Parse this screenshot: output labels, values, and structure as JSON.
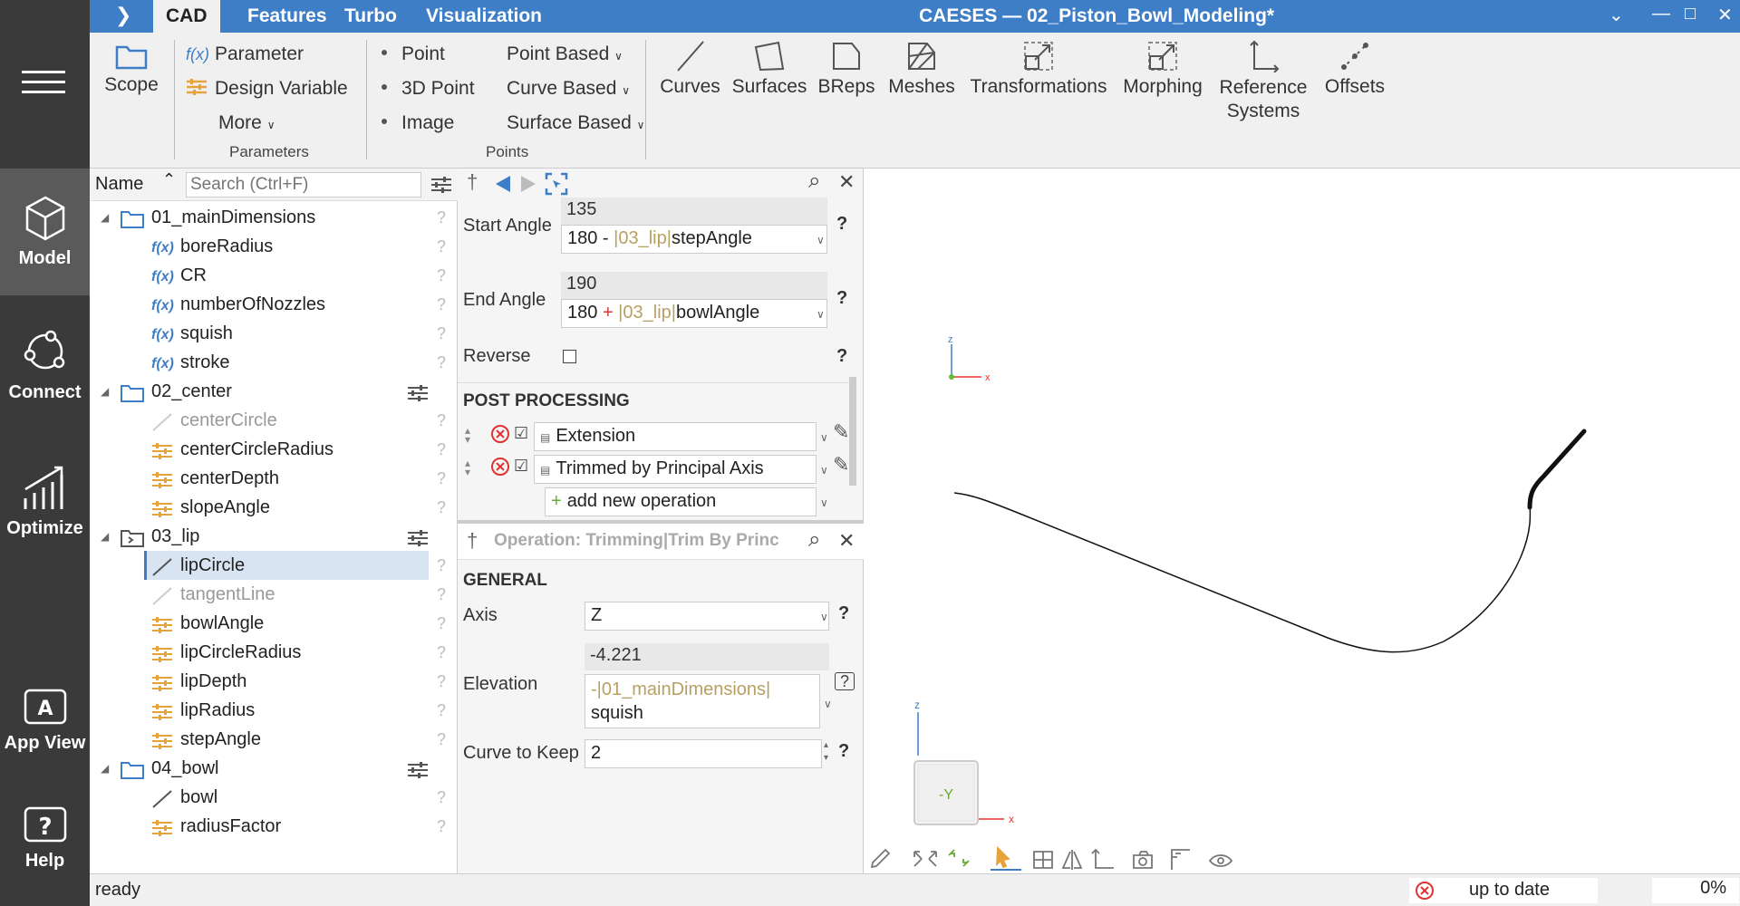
{
  "nav": {
    "model": "Model",
    "connect": "Connect",
    "optimize": "Optimize",
    "app_view": "App View",
    "help": "Help"
  },
  "titlebar": {
    "tabs": [
      "CAD",
      "Features",
      "Turbo",
      "Visualization"
    ],
    "window_title": "CAESES — 02_Piston_Bowl_Modeling*"
  },
  "ribbon": {
    "scope": "Scope",
    "parameter": "Parameter",
    "design_variable": "Design Variable",
    "more": "More",
    "parameters_group": "Parameters",
    "point": "Point",
    "point3d": "3D Point",
    "image": "Image",
    "point_based": "Point Based",
    "curve_based": "Curve Based",
    "surface_based": "Surface Based",
    "points_group": "Points",
    "curves": "Curves",
    "surfaces": "Surfaces",
    "breps": "BReps",
    "meshes": "Meshes",
    "transformations": "Transformations",
    "morphing": "Morphing",
    "reference_systems_1": "Reference",
    "reference_systems_2": "Systems",
    "offsets": "Offsets",
    "fx": "f(x)"
  },
  "tree": {
    "name_header": "Name",
    "search_placeholder": "Search (Ctrl+F)",
    "fx": "f(x)",
    "q": "?",
    "items": [
      {
        "label": "01_mainDimensions"
      },
      {
        "label": "boreRadius"
      },
      {
        "label": "CR"
      },
      {
        "label": "numberOfNozzles"
      },
      {
        "label": "squish"
      },
      {
        "label": "stroke"
      },
      {
        "label": "02_center"
      },
      {
        "label": "centerCircle"
      },
      {
        "label": "centerCircleRadius"
      },
      {
        "label": "centerDepth"
      },
      {
        "label": "slopeAngle"
      },
      {
        "label": "03_lip"
      },
      {
        "label": "lipCircle"
      },
      {
        "label": "tangentLine"
      },
      {
        "label": "bowlAngle"
      },
      {
        "label": "lipCircleRadius"
      },
      {
        "label": "lipDepth"
      },
      {
        "label": "lipRadius"
      },
      {
        "label": "stepAngle"
      },
      {
        "label": "04_bowl"
      },
      {
        "label": "bowl"
      },
      {
        "label": "radiusFactor"
      }
    ]
  },
  "editor": {
    "start_angle_label": "Start Angle",
    "start_angle_value": "135",
    "start_angle_expr_pre": "180 - ",
    "start_angle_expr_ref": "|03_lip|",
    "start_angle_expr_post": "stepAngle",
    "end_angle_label": "End Angle",
    "end_angle_value": "190",
    "end_angle_expr_pre": "180 ",
    "end_angle_expr_op": "+",
    "end_angle_expr_ref": " |03_lip|",
    "end_angle_expr_post": "bowlAngle",
    "reverse_label": "Reverse",
    "post_processing": "POST PROCESSING",
    "op1": "Extension",
    "op2": "Trimmed by Principal Axis",
    "add_op": "add new operation",
    "operation_title": "Operation: Trimming|Trim By Princ",
    "general": "GENERAL",
    "axis_label": "Axis",
    "axis_value": "Z",
    "elevation_label": "Elevation",
    "elevation_value": "-4.221",
    "elevation_expr_ref": "-|01_mainDimensions|",
    "elevation_expr_post": "squish",
    "curve_keep_label": "Curve to Keep",
    "curve_keep_value": "2",
    "q": "?"
  },
  "viewport": {
    "axis_z": "z",
    "axis_x": "x",
    "cube_label": "-Y"
  },
  "status": {
    "text": "ready",
    "up_to_date": "up to date",
    "progress": "0%"
  }
}
